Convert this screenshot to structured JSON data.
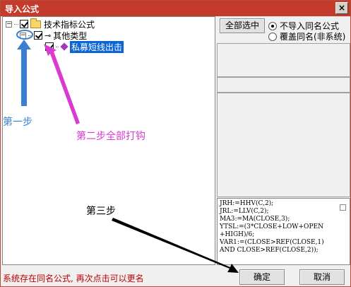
{
  "window": {
    "title": "导入公式",
    "close_symbol": "×"
  },
  "tree": {
    "root": {
      "label": "技术指标公式",
      "expander": "⊟"
    },
    "group": {
      "label": "其他类型",
      "expander": "⊟"
    },
    "item": {
      "label": "私募短线出击"
    }
  },
  "buttons": {
    "select_all": "全部选中",
    "ok": "确定",
    "cancel": "取消"
  },
  "options": {
    "no_import_same_name": "不导入同名公式",
    "overwrite_same_name": "覆盖同名(非系统)",
    "selected": "no_import_same_name"
  },
  "formula_code": [
    "JRH:=HHV(C,2);",
    "JRL:=LLV(C,2);",
    "MA3:=MA(CLOSE,3);",
    "YTSL:=(3*CLOSE+LOW+OPEN",
    "+HIGH)/6;",
    "VAR1:=(CLOSE>REF(CLOSE,1)",
    "AND CLOSE>REF(CLOSE,2));"
  ],
  "status": {
    "message": "系统存在同名公式, 再次点击可以更名"
  },
  "annotations": {
    "step1": "第一步",
    "step2": "第二步全部打钩",
    "step3": "第三步"
  },
  "colors": {
    "titlebar": "#c43b2c",
    "selection": "#0a64d6",
    "status_text": "#c00000",
    "step1": "#3b7fd0",
    "step2": "#d93ad0",
    "step3": "#000000"
  }
}
